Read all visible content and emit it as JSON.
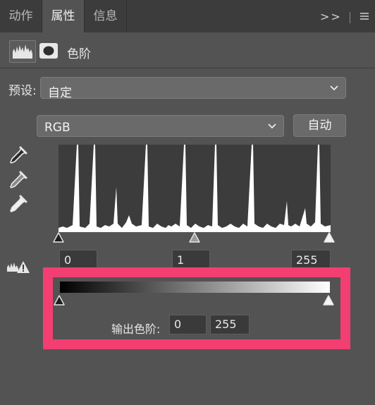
{
  "tabs": [
    {
      "label": "动作",
      "active": false
    },
    {
      "label": "属性",
      "active": true
    },
    {
      "label": "信息",
      "active": false
    }
  ],
  "panel_menu_icon": "double-chevron-right-menu-icon",
  "adjustment": {
    "title": "色阶",
    "icons": [
      "levels-histogram-icon",
      "layer-mask-icon"
    ]
  },
  "preset": {
    "label": "预设:",
    "value": "自定"
  },
  "channel": {
    "value": "RGB",
    "auto_label": "自动"
  },
  "eyedroppers": [
    "black-point-eyedropper-icon",
    "gray-point-eyedropper-icon",
    "white-point-eyedropper-icon"
  ],
  "input_levels": {
    "black": "0",
    "gamma": "1",
    "white": "255"
  },
  "warning_icon": "clipping-warning-icon",
  "output_levels": {
    "label": "输出色阶:",
    "black": "0",
    "white": "255"
  },
  "colors": {
    "panel": "#535353",
    "tabbar": "#3c3c3c",
    "highlight": "#f33e72"
  }
}
